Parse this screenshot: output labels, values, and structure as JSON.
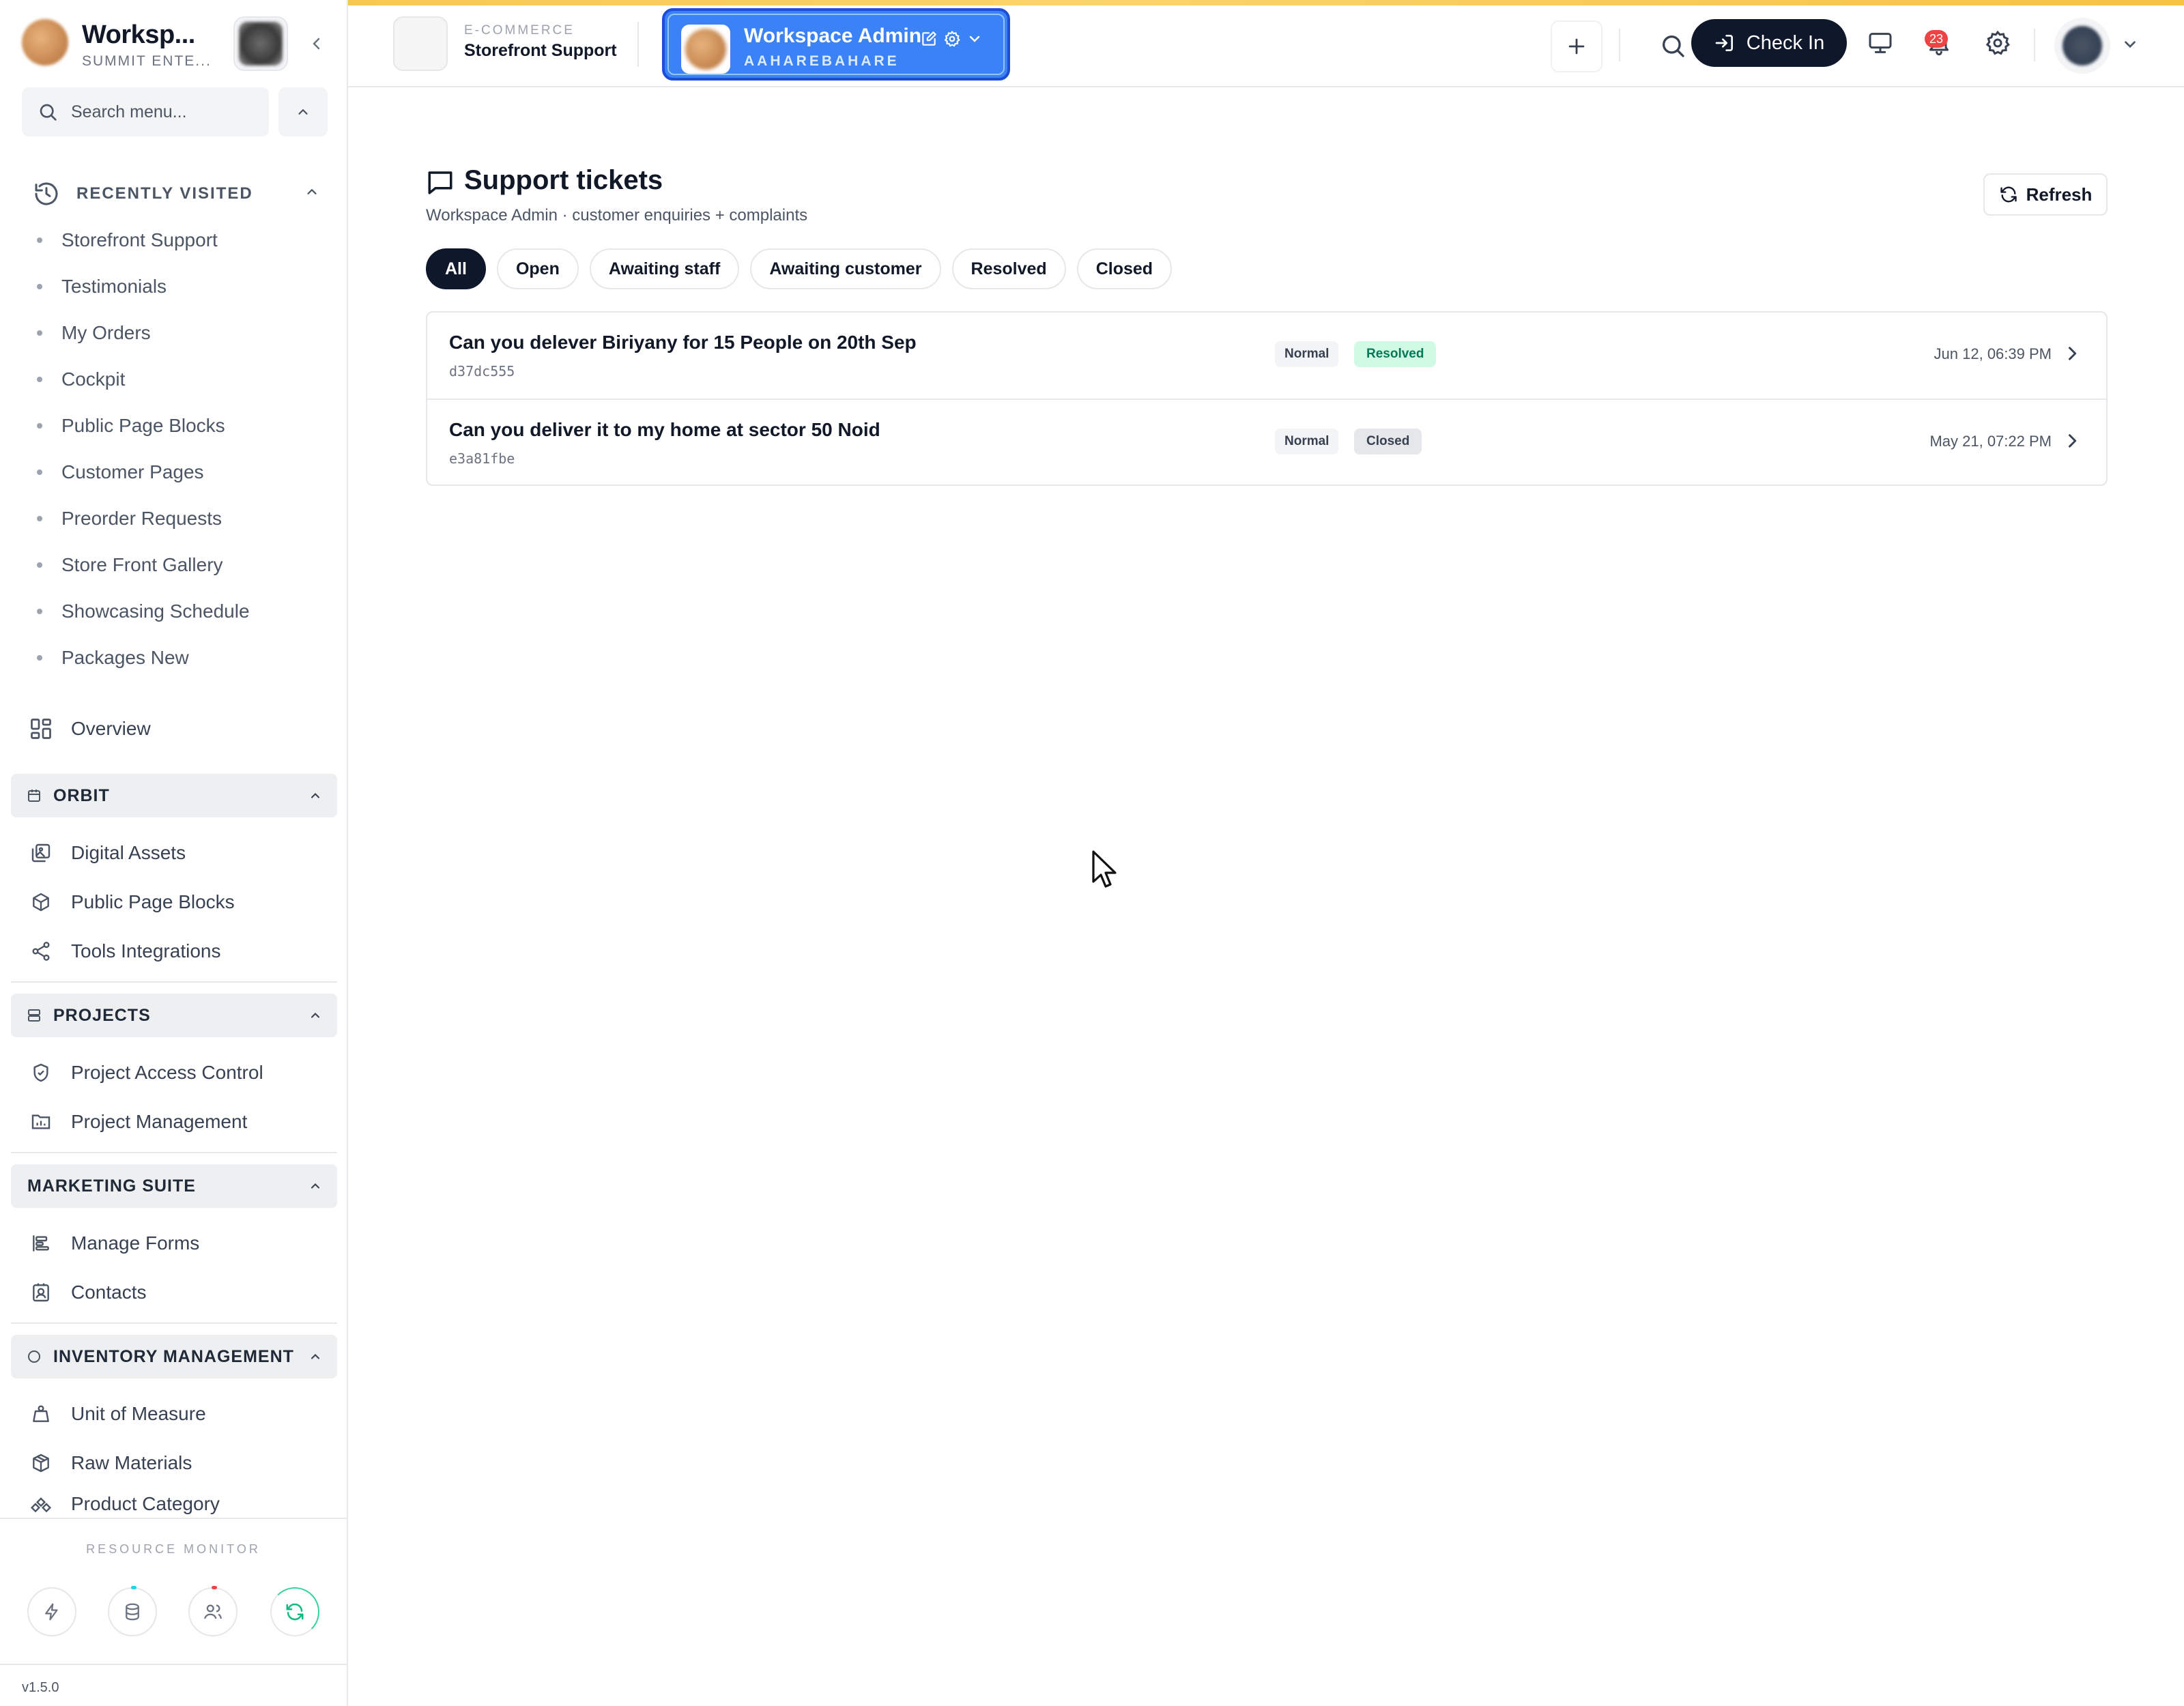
{
  "colors": {
    "accent": "#3b82f6",
    "dark": "#0f172a",
    "badge": "#ef4444",
    "resolved_bg": "#d1fae5",
    "resolved_fg": "#047857",
    "top_stripe": "#f6c244"
  },
  "sidebar": {
    "workspace_name": "Worksp...",
    "workspace_org": "SUMMIT ENTE...",
    "search_placeholder": "Search menu...",
    "recent_label": "RECENTLY VISITED",
    "recent": [
      "Storefront Support",
      "Testimonials",
      "My Orders",
      "Cockpit",
      "Public Page Blocks",
      "Customer Pages",
      "Preorder Requests",
      "Store Front Gallery",
      "Showcasing Schedule",
      "Packages New"
    ],
    "overview_label": "Overview",
    "sections": [
      {
        "title": "ORBIT",
        "icon": "calendar-icon",
        "items": [
          {
            "label": "Digital Assets",
            "icon": "images-icon"
          },
          {
            "label": "Public Page Blocks",
            "icon": "cube-icon"
          },
          {
            "label": "Tools Integrations",
            "icon": "share-icon"
          }
        ]
      },
      {
        "title": "PROJECTS",
        "icon": "server-icon",
        "items": [
          {
            "label": "Project Access Control",
            "icon": "shield-check-icon"
          },
          {
            "label": "Project Management",
            "icon": "chart-folder-icon"
          }
        ]
      },
      {
        "title": "MARKETING SUITE",
        "icon": "",
        "items": [
          {
            "label": "Manage Forms",
            "icon": "align-left-icon"
          },
          {
            "label": "Contacts",
            "icon": "contact-card-icon"
          }
        ]
      },
      {
        "title": "INVENTORY MANAGEMENT",
        "icon": "circle-icon",
        "items": [
          {
            "label": "Unit of Measure",
            "icon": "scale-icon"
          },
          {
            "label": "Raw Materials",
            "icon": "boxes-icon"
          },
          {
            "label": "Product Category",
            "icon": "shapes-icon"
          }
        ]
      }
    ],
    "resource_monitor_label": "RESOURCE MONITOR",
    "version": "v1.5.0"
  },
  "topbar": {
    "app_category": "E-COMMERCE",
    "app_name": "Storefront Support",
    "workspace_switch_name": "Workspace Admin",
    "workspace_switch_slug": "AAHAREBAHARE",
    "checkin_label": "Check In",
    "notification_count": "23"
  },
  "main": {
    "title": "Support tickets",
    "subtitle": "Workspace Admin · customer enquiries + complaints",
    "refresh_label": "Refresh",
    "filters": [
      {
        "label": "All",
        "active": true
      },
      {
        "label": "Open",
        "active": false
      },
      {
        "label": "Awaiting staff",
        "active": false
      },
      {
        "label": "Awaiting customer",
        "active": false
      },
      {
        "label": "Resolved",
        "active": false
      },
      {
        "label": "Closed",
        "active": false
      }
    ],
    "tickets": [
      {
        "title": "Can you delever Biriyany for 15 People on 20th Sep",
        "id": "d37dc555",
        "priority": "Normal",
        "status": "Resolved",
        "status_kind": "resolved",
        "date": "Jun 12, 06:39 PM"
      },
      {
        "title": "Can you deliver it to my home at sector 50 Noid",
        "id": "e3a81fbe",
        "priority": "Normal",
        "status": "Closed",
        "status_kind": "closed",
        "date": "May 21, 07:22 PM"
      }
    ]
  }
}
